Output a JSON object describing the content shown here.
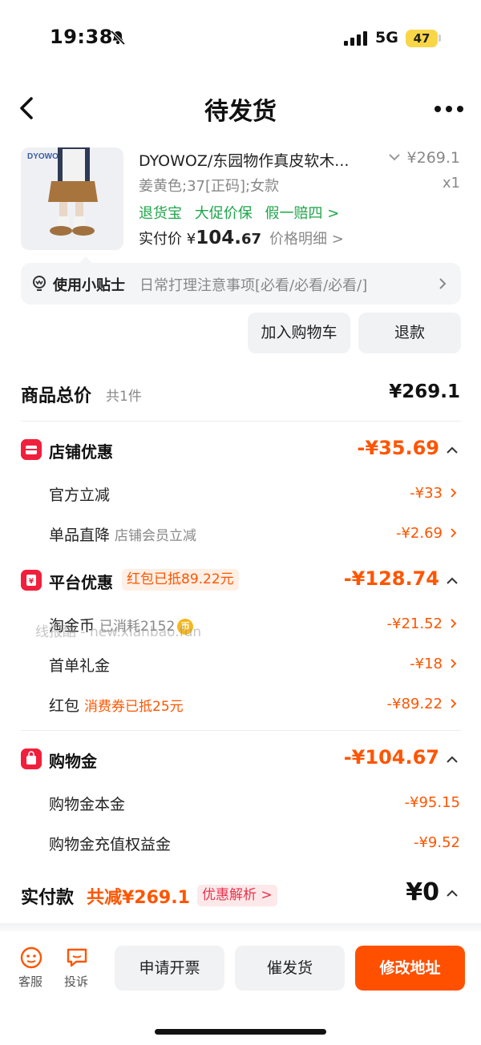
{
  "status_bar": {
    "time": "19:38",
    "network": "5G",
    "battery": "47"
  },
  "nav": {
    "title": "待发货"
  },
  "product": {
    "brand_on_image": "DYOWOZ",
    "title": "DYOWOZ/东园物作真皮软木...",
    "price": "¥269.1",
    "spec": "姜黄色;37[正码];女款",
    "qty": "x1",
    "services": [
      "退货宝",
      "大促价保",
      "假一赔四 >"
    ],
    "paid_label": "实付价 ¥",
    "paid_int": "104.",
    "paid_dec": "67",
    "price_detail": "价格明细 >"
  },
  "tips": {
    "label": "使用小贴士",
    "text": "日常打理注意事项[必看/必看/必看/]"
  },
  "actions": {
    "add_cart": "加入购物车",
    "refund": "退款"
  },
  "summary": {
    "title": "商品总价",
    "count": "共1件",
    "total": "¥269.1"
  },
  "shop_discount": {
    "title": "店铺优惠",
    "total": "-¥35.69",
    "rows": [
      {
        "label": "官方立减",
        "sub": "",
        "value": "-¥33"
      },
      {
        "label": "单品直降",
        "sub": "店铺会员立减",
        "value": "-¥2.69"
      }
    ]
  },
  "platform_discount": {
    "title": "平台优惠",
    "tag": "红包已抵89.22元",
    "total": "-¥128.74",
    "rows": [
      {
        "label": "淘金币",
        "sub": "已消耗2152",
        "value": "-¥21.52"
      },
      {
        "label": "首单礼金",
        "sub": "",
        "value": "-¥18"
      },
      {
        "label": "红包",
        "sub": "消费券已抵25元",
        "value": "-¥89.22"
      }
    ]
  },
  "shopping_gold": {
    "title": "购物金",
    "total": "-¥104.67",
    "rows": [
      {
        "label": "购物金本金",
        "value": "-¥95.15"
      },
      {
        "label": "购物金充值权益金",
        "value": "-¥9.52"
      }
    ]
  },
  "watermark": "线报酷 - new.xianbao.fun",
  "payment": {
    "label": "实付款",
    "saving": "共减¥269.1",
    "analysis": "优惠解析 >",
    "total": "¥0"
  },
  "bottom_bar": {
    "service": "客服",
    "complain": "投诉",
    "invoice": "申请开票",
    "urge": "催发货",
    "modify_address": "修改地址"
  },
  "colors": {
    "accent_orange": "#ff5500",
    "red": "#f0203c",
    "green": "#1ea64a",
    "battery": "#f8d648"
  }
}
